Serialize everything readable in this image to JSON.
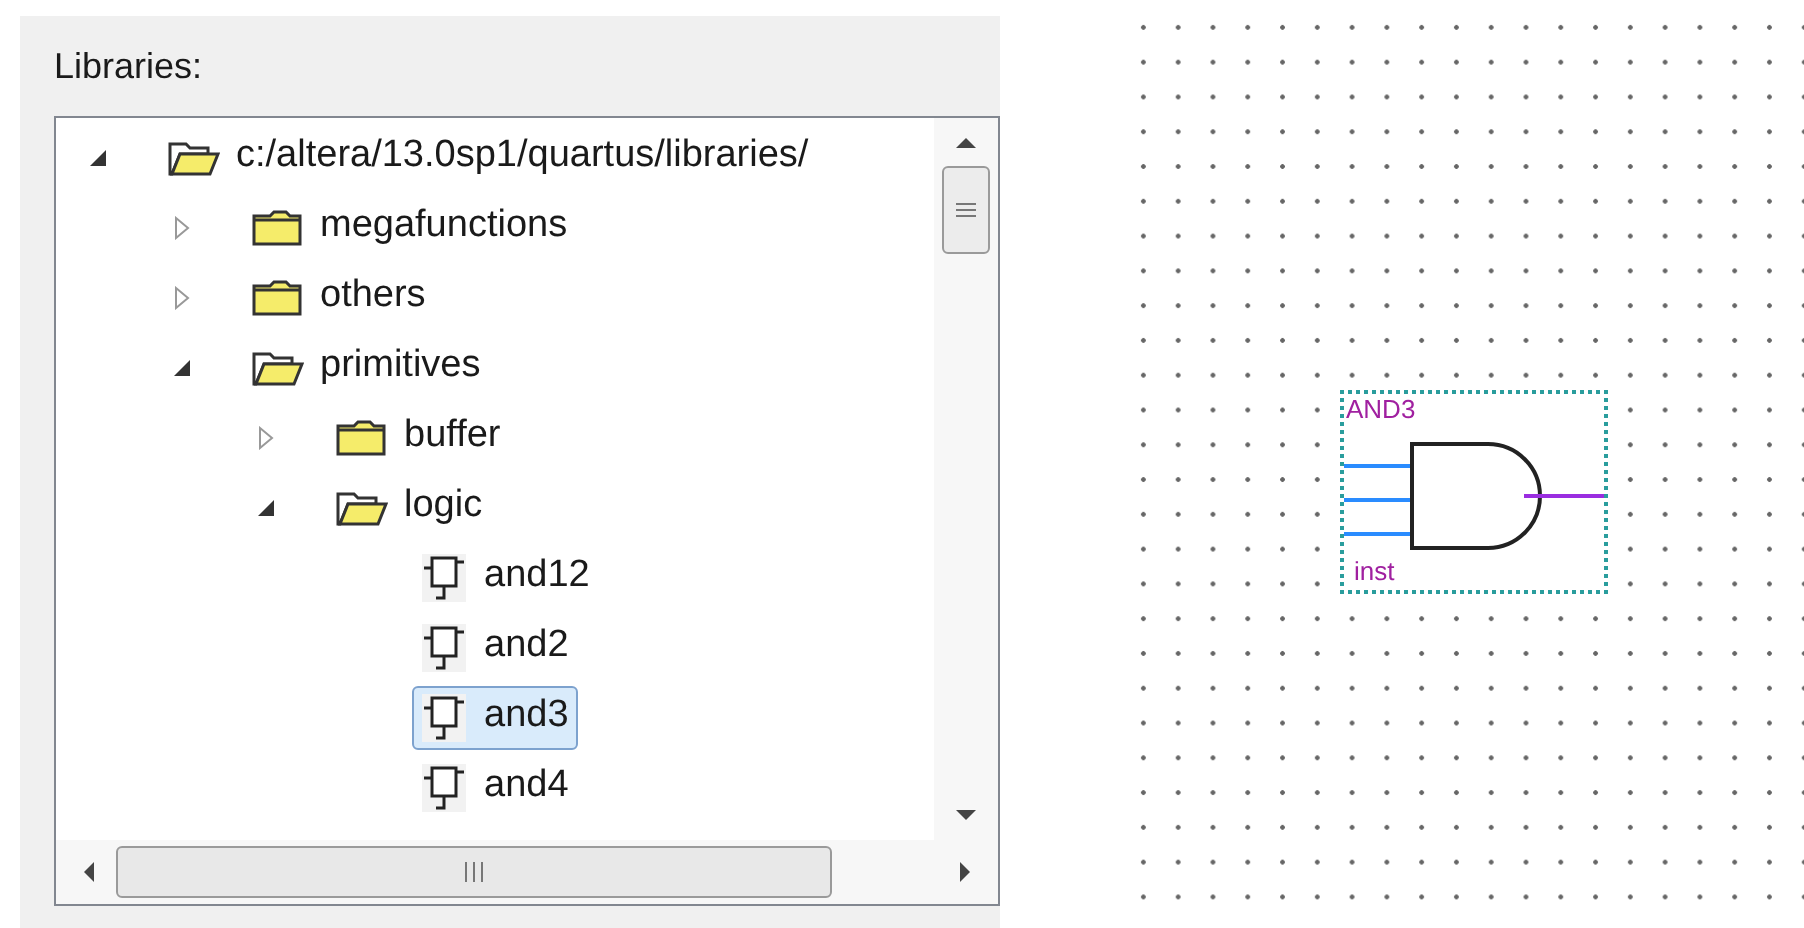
{
  "libraries_label": "Libraries:",
  "tree": [
    {
      "kind": "folder",
      "label": "c:/altera/13.0sp1/quartus/libraries/",
      "expanded": true,
      "selected": false,
      "children": [
        {
          "kind": "folder",
          "label": "megafunctions",
          "expanded": false,
          "selected": false
        },
        {
          "kind": "folder",
          "label": "others",
          "expanded": false,
          "selected": false
        },
        {
          "kind": "folder",
          "label": "primitives",
          "expanded": true,
          "selected": false,
          "children": [
            {
              "kind": "folder",
              "label": "buffer",
              "expanded": false,
              "selected": false
            },
            {
              "kind": "folder",
              "label": "logic",
              "expanded": true,
              "selected": false,
              "children": [
                {
                  "kind": "symbol",
                  "label": "and12",
                  "selected": false
                },
                {
                  "kind": "symbol",
                  "label": "and2",
                  "selected": false
                },
                {
                  "kind": "symbol",
                  "label": "and3",
                  "selected": true
                },
                {
                  "kind": "symbol",
                  "label": "and4",
                  "selected": false
                }
              ]
            }
          ]
        }
      ]
    }
  ],
  "canvas": {
    "symbol": {
      "name": "AND3",
      "instance": "inst"
    }
  }
}
